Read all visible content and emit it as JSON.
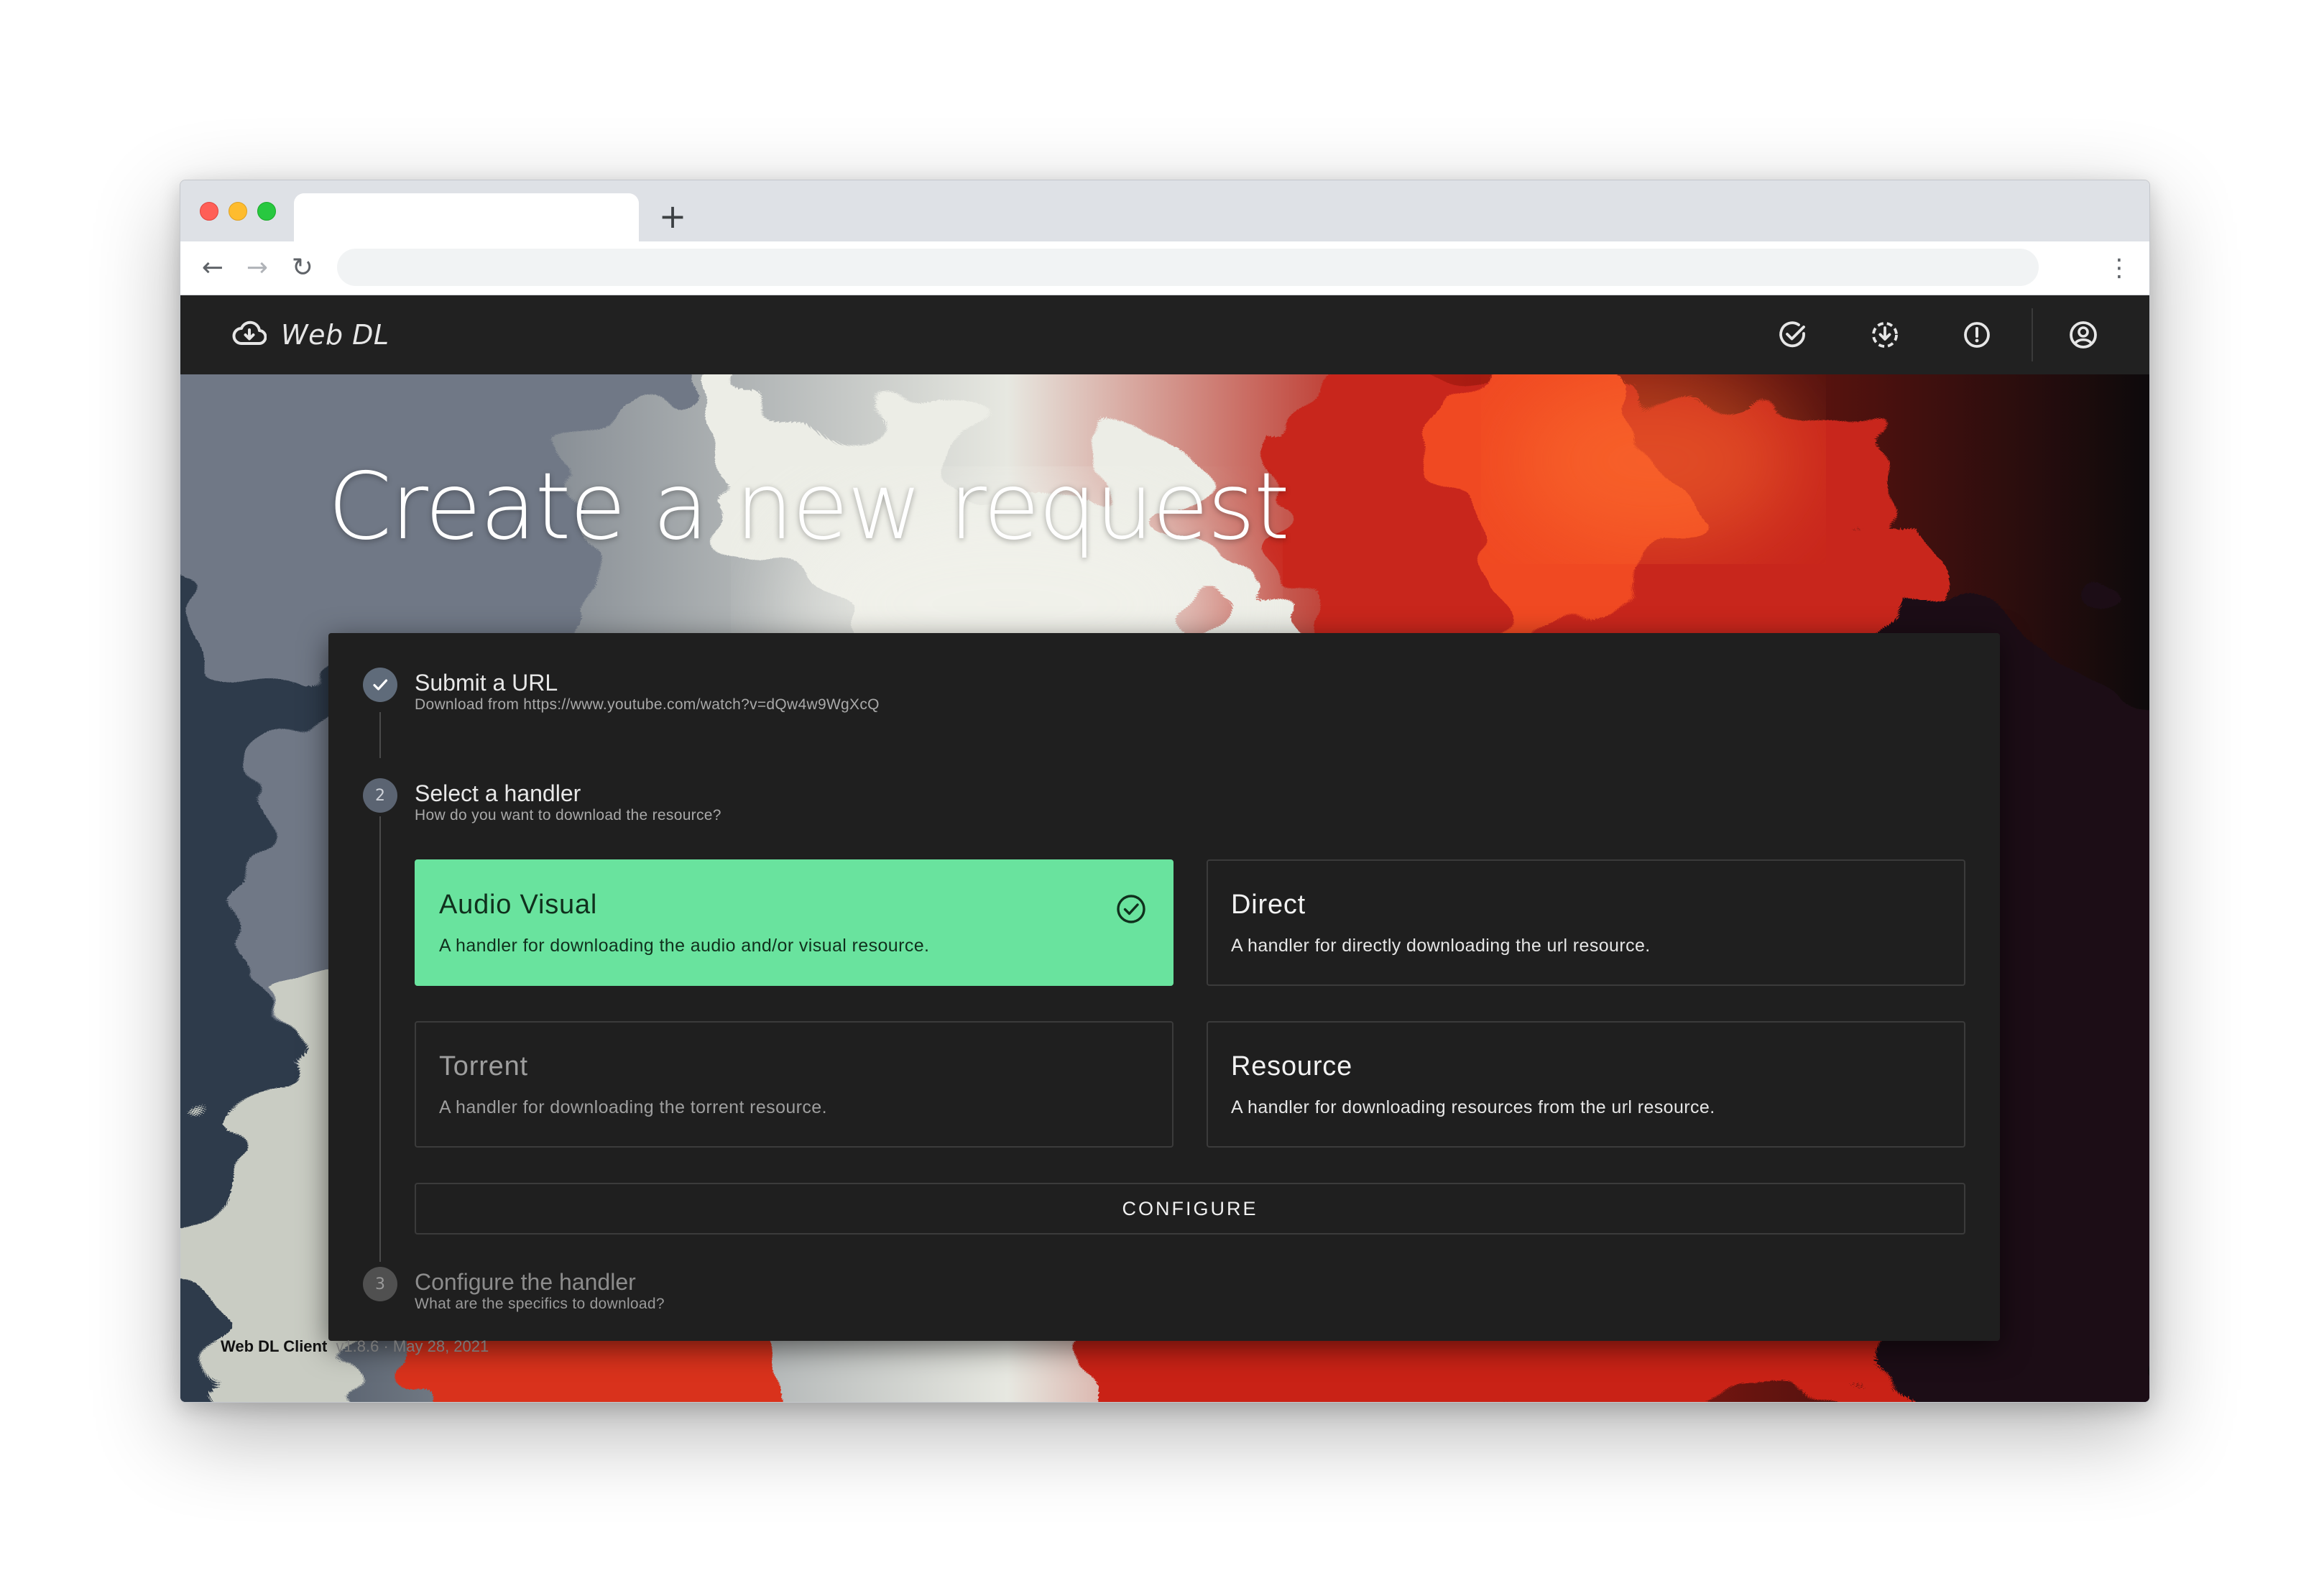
{
  "browser": {
    "tab_title": "",
    "new_tab_label": "+",
    "address": "",
    "nav_back": "←",
    "nav_forward": "→",
    "nav_reload": "↻",
    "menu": "⋮"
  },
  "app": {
    "title": "Web DL",
    "icons": [
      "cloud-download-icon",
      "check-circle-icon",
      "download-circle-icon",
      "alert-circle-icon",
      "account-icon"
    ]
  },
  "hero": {
    "title": "Create a new request"
  },
  "stepper": {
    "steps": [
      {
        "number": "",
        "title": "Submit a URL",
        "subtitle": "Download from https://www.youtube.com/watch?v=dQw4w9WgXcQ",
        "state": "complete"
      },
      {
        "number": "2",
        "title": "Select a handler",
        "subtitle": "How do you want to download the resource?",
        "state": "active"
      },
      {
        "number": "3",
        "title": "Configure the handler",
        "subtitle": "What are the specifics to download?",
        "state": "pending"
      }
    ],
    "handlers": [
      {
        "title": "Audio Visual",
        "description": "A handler for downloading the audio and/or visual resource.",
        "selected": true
      },
      {
        "title": "Direct",
        "description": "A handler for directly downloading the url resource.",
        "selected": false
      },
      {
        "title": "Torrent",
        "description": "A handler for downloading the torrent resource.",
        "selected": false,
        "disabled": true
      },
      {
        "title": "Resource",
        "description": "A handler for downloading resources from the url resource.",
        "selected": false
      }
    ],
    "configure_label": "CONFIGURE"
  },
  "footer": {
    "name": "Web DL Client",
    "version": "v1.8.6 · May 28, 2021"
  },
  "colors": {
    "accent": "#69e39e",
    "appbar": "#212121",
    "card": "#1f1f1f"
  }
}
